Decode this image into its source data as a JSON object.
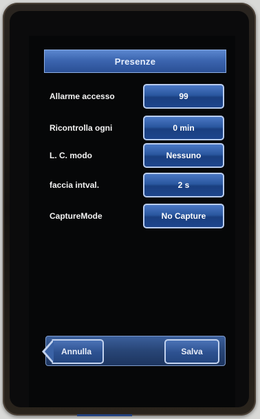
{
  "screen": {
    "title": "Presenze",
    "settings": [
      {
        "label": "Allarme accesso",
        "value": "99"
      },
      {
        "label": "Ricontrolla ogni",
        "value": "0 min"
      },
      {
        "label": "L. C. modo",
        "value": "Nessuno"
      },
      {
        "label": "faccia intval.",
        "value": "2 s"
      },
      {
        "label": "CaptureMode",
        "value": "No Capture"
      }
    ],
    "buttons": {
      "cancel": "Annulla",
      "save": "Salva"
    }
  },
  "colors": {
    "accent": "#3c66b0",
    "screen_bg": "#060708",
    "button_border": "#b9cdf0"
  }
}
